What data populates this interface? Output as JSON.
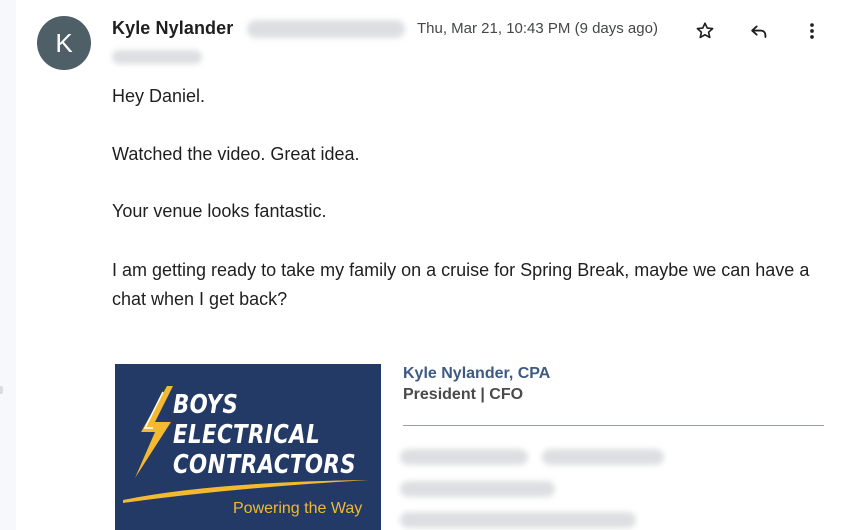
{
  "email": {
    "sender_initial": "K",
    "sender_name": "Kyle Nylander",
    "date": "Thu, Mar 21, 10:43 PM (9 days ago)",
    "body_lines": [
      "Hey Daniel.",
      "Watched the video. Great idea.",
      "Your venue looks fantastic.",
      "I am getting ready to take my family on a cruise for Spring Break, maybe we can have a chat when I get back?"
    ]
  },
  "signature": {
    "name": "Kyle Nylander, CPA",
    "title": "President | CFO",
    "logo": {
      "line1": "BOYS",
      "line2": "ELECTRICAL",
      "line3": "CONTRACTORS",
      "tagline": "Powering the Way"
    }
  },
  "icons": {
    "star": "star-icon",
    "reply": "reply-icon",
    "more": "more-vert-icon"
  },
  "colors": {
    "avatar_bg": "#4f5f68",
    "logo_bg": "#243a66",
    "logo_accent": "#f2b931",
    "sig_name": "#3d5a85"
  }
}
